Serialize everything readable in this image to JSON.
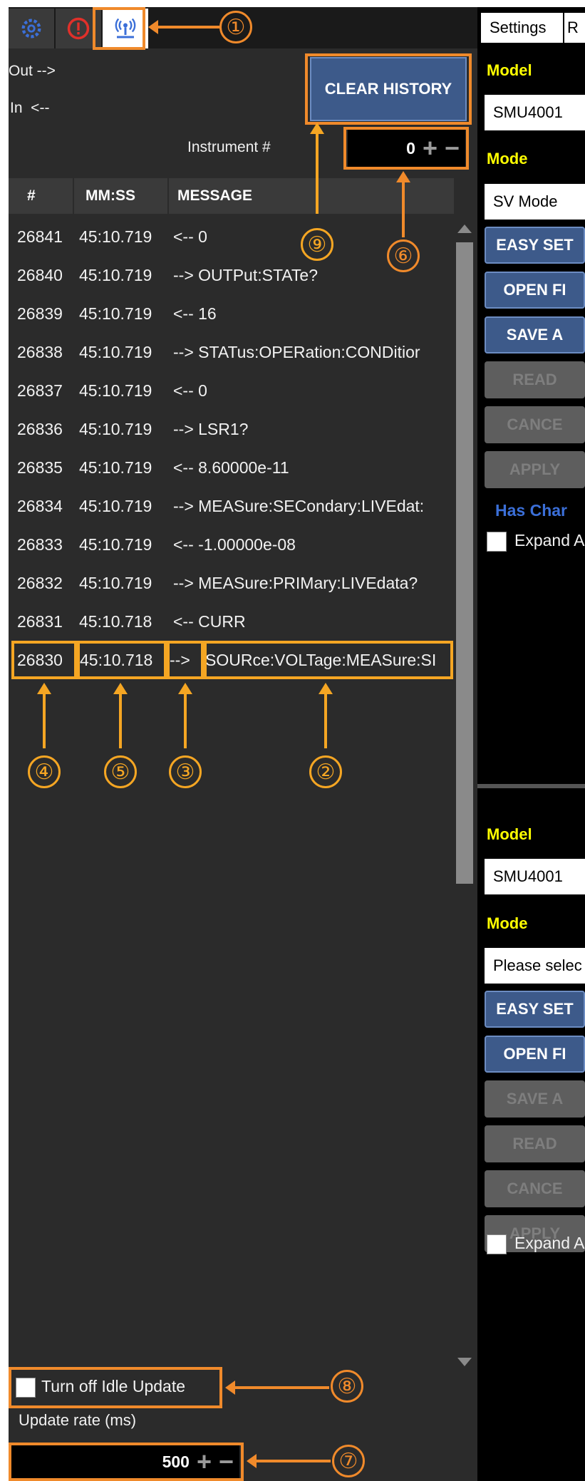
{
  "top_tabs": {
    "settings_icon": "gear-icon",
    "alert_icon": "alert-circle-icon",
    "comm_icon": "broadcast-icon"
  },
  "log": {
    "out_label": "Out -->",
    "in_label": "In  <--",
    "clear_history": "CLEAR HISTORY",
    "instrument_label": "Instrument #",
    "instrument_value": "0",
    "columns": [
      "#",
      "MM:SS",
      "MESSAGE"
    ],
    "rows": [
      {
        "num": "26841",
        "time": "45:10.719",
        "msg": "<-- 0"
      },
      {
        "num": "26840",
        "time": "45:10.719",
        "msg": "--> OUTPut:STATe?"
      },
      {
        "num": "26839",
        "time": "45:10.719",
        "msg": "<-- 16"
      },
      {
        "num": "26838",
        "time": "45:10.719",
        "msg": "--> STATus:OPERation:CONDitior"
      },
      {
        "num": "26837",
        "time": "45:10.719",
        "msg": "<-- 0"
      },
      {
        "num": "26836",
        "time": "45:10.719",
        "msg": "--> LSR1?"
      },
      {
        "num": "26835",
        "time": "45:10.719",
        "msg": "<-- 8.60000e-11"
      },
      {
        "num": "26834",
        "time": "45:10.719",
        "msg": "--> MEASure:SECondary:LIVEdat:"
      },
      {
        "num": "26833",
        "time": "45:10.719",
        "msg": "<-- -1.00000e-08"
      },
      {
        "num": "26832",
        "time": "45:10.719",
        "msg": "--> MEASure:PRIMary:LIVEdata?"
      },
      {
        "num": "26831",
        "time": "45:10.718",
        "msg": "<-- CURR"
      }
    ],
    "highlight_row": {
      "num": "26830",
      "time": "45:10.718",
      "dir": "-->",
      "msg": "SOURce:VOLTage:MEASure:SI"
    },
    "idle_update_label": "Turn off Idle Update",
    "update_rate_label": "Update rate (ms)",
    "update_rate_value": "500"
  },
  "right": {
    "tab_settings": "Settings",
    "tab_r": "R",
    "upper": {
      "model_label": "Model",
      "model_value": "SMU4001",
      "mode_label": "Mode",
      "mode_value": "SV Mode",
      "buttons": [
        "EASY SET",
        "OPEN FI",
        "SAVE A",
        "READ",
        "CANCE",
        "APPLY"
      ],
      "has_changes": "Has Char",
      "expand": "Expand A"
    },
    "lower": {
      "model_label": "Model",
      "model_value": "SMU4001",
      "mode_label": "Mode",
      "mode_value": "Please selec",
      "buttons": [
        "EASY SET",
        "OPEN FI",
        "SAVE A",
        "READ",
        "CANCE",
        "APPLY"
      ],
      "expand": "Expand A"
    }
  },
  "annotations": [
    "①",
    "②",
    "③",
    "④",
    "⑤",
    "⑥",
    "⑦",
    "⑧",
    "⑨"
  ],
  "colors": {
    "annotation_yellow": "#f5a623",
    "annotation_orange": "#f08a2b",
    "accent_blue": "#3d5a8a",
    "label_yellow": "#ffff00"
  }
}
